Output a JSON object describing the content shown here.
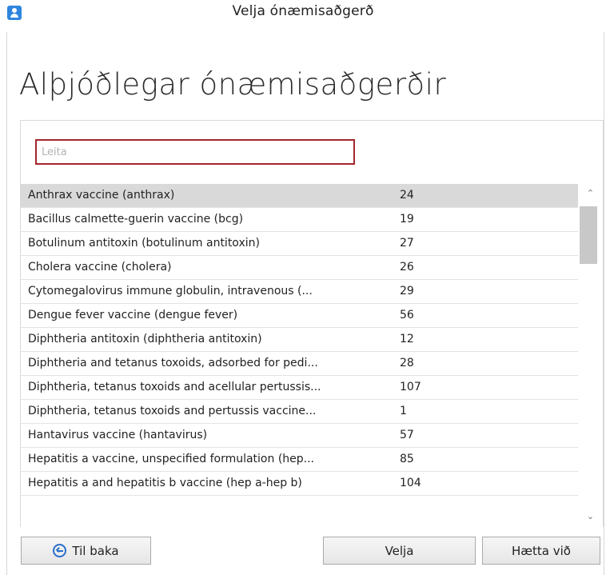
{
  "window": {
    "title": "Velja ónæmisaðgerð",
    "icon": "user-app-icon"
  },
  "page": {
    "title": "Alþjóðlegar ónæmisaðgerðir"
  },
  "search": {
    "placeholder": "Leita",
    "value": ""
  },
  "list": {
    "selected_index": 0,
    "rows": [
      {
        "name": "Anthrax vaccine (anthrax)",
        "count": "24"
      },
      {
        "name": "Bacillus calmette-guerin vaccine (bcg)",
        "count": "19"
      },
      {
        "name": "Botulinum antitoxin (botulinum antitoxin)",
        "count": "27"
      },
      {
        "name": "Cholera vaccine (cholera)",
        "count": "26"
      },
      {
        "name": "Cytomegalovirus immune globulin, intravenous (...",
        "count": "29"
      },
      {
        "name": "Dengue fever vaccine (dengue fever)",
        "count": "56"
      },
      {
        "name": "Diphtheria antitoxin (diphtheria antitoxin)",
        "count": "12"
      },
      {
        "name": "Diphtheria and tetanus toxoids, adsorbed for pedi...",
        "count": "28"
      },
      {
        "name": "Diphtheria, tetanus toxoids and acellular pertussis...",
        "count": "107"
      },
      {
        "name": "Diphtheria, tetanus toxoids and pertussis vaccine...",
        "count": "1"
      },
      {
        "name": "Hantavirus vaccine (hantavirus)",
        "count": "57"
      },
      {
        "name": "Hepatitis a vaccine, unspecified formulation (hep...",
        "count": "85"
      },
      {
        "name": "Hepatitis a and hepatitis b vaccine (hep a-hep b)",
        "count": "104"
      }
    ]
  },
  "buttons": {
    "back": "Til baka",
    "select": "Velja",
    "cancel": "Hætta við"
  },
  "colors": {
    "search_border": "#a4262c",
    "selected_row": "#d9d9d9",
    "accent": "#2a6fc9"
  }
}
